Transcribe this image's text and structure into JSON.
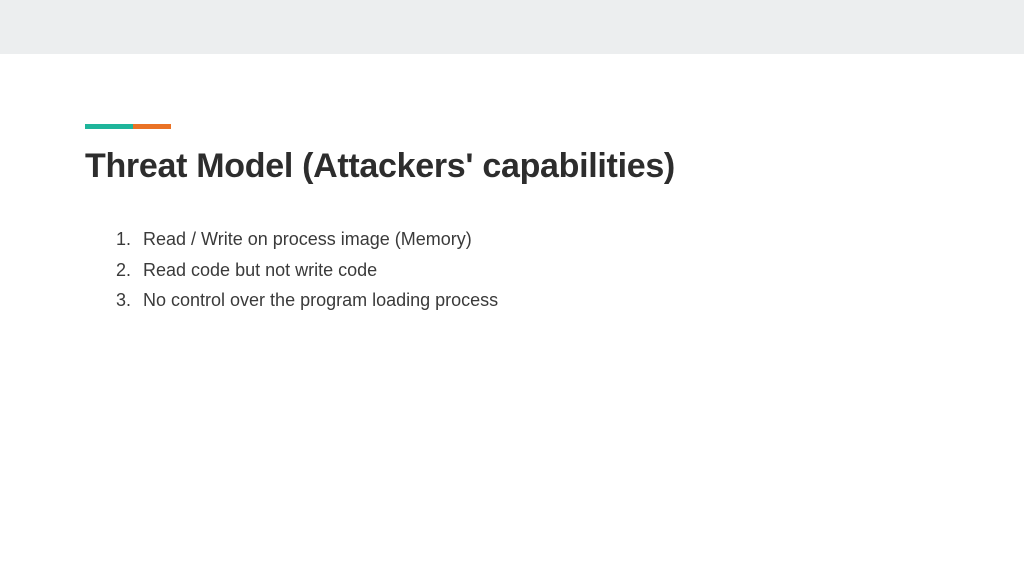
{
  "title": "Threat Model (Attackers' capabilities)",
  "items": [
    {
      "num": "1.",
      "text": "Read / Write on process image (Memory)"
    },
    {
      "num": "2.",
      "text": "Read code but not write code"
    },
    {
      "num": "3.",
      "text": "No control over the program loading process"
    }
  ]
}
